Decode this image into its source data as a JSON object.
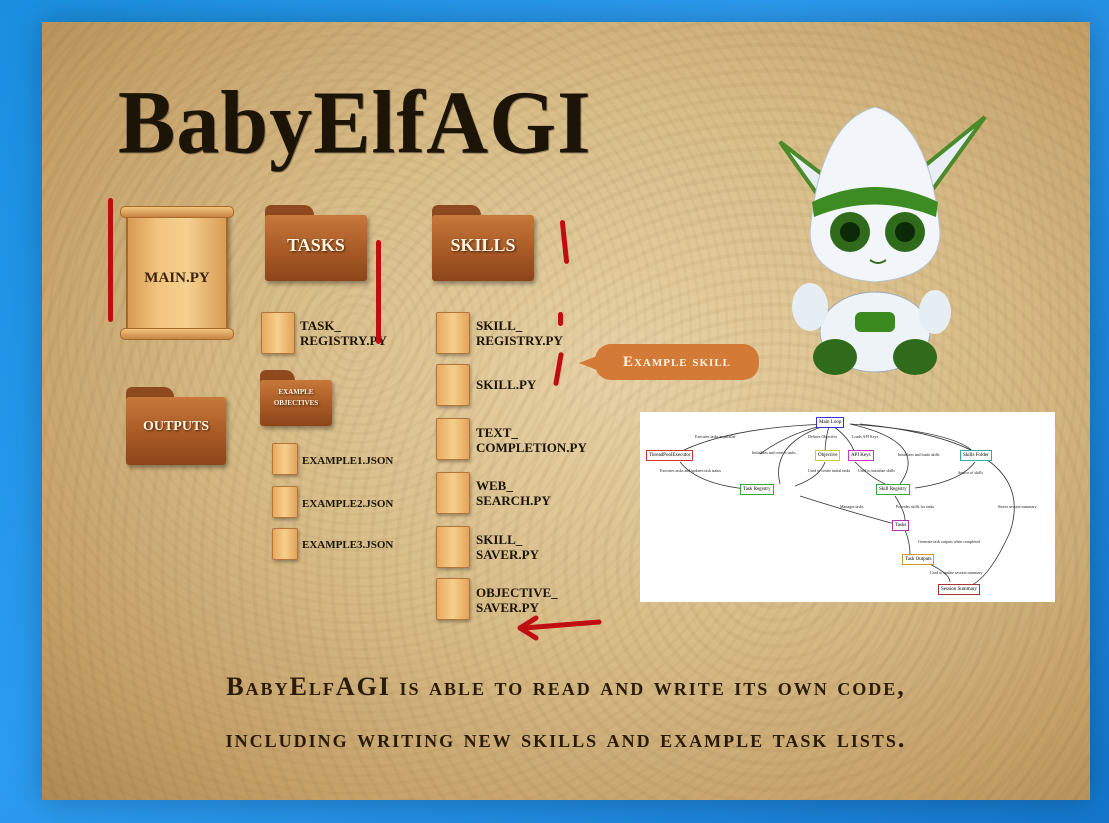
{
  "title": "BabyElfAGI",
  "main_scroll": {
    "label": "MAIN.PY"
  },
  "folders": {
    "outputs": "OUTPUTS",
    "tasks": "TASKS",
    "skills": "SKILLS",
    "example_objectives": "EXAMPLE\nOBJECTIVES"
  },
  "task_files": [
    {
      "name": "TASK_\nREGISTRY.PY"
    }
  ],
  "example_files": [
    {
      "name": "EXAMPLE1.JSON"
    },
    {
      "name": "EXAMPLE2.JSON"
    },
    {
      "name": "EXAMPLE3.JSON"
    }
  ],
  "skill_files": [
    {
      "name": "SKILL_\nREGISTRY.PY"
    },
    {
      "name": "SKILL.PY"
    },
    {
      "name": "TEXT_\nCOMPLETION.PY"
    },
    {
      "name": "WEB_\nSEARCH.PY"
    },
    {
      "name": "SKILL_\nSAVER.PY"
    },
    {
      "name": "OBJECTIVE_\nSAVER.PY"
    }
  ],
  "callout": "Example skill",
  "diagram": {
    "nodes": {
      "main_loop": {
        "label": "Main Loop",
        "color": "#3333cc"
      },
      "executor": {
        "label": "ThreadPoolExecutor",
        "color": "#cc3333"
      },
      "objective": {
        "label": "Objective",
        "color": "#cccc33"
      },
      "api_keys": {
        "label": "API Keys",
        "color": "#cc33cc"
      },
      "skills_folder": {
        "label": "Skills Folder",
        "color": "#33aaaa"
      },
      "task_registry": {
        "label": "Task Registry",
        "color": "#33aa33"
      },
      "skill_registry": {
        "label": "Skill Registry",
        "color": "#33aa33"
      },
      "tasks": {
        "label": "Tasks",
        "color": "#aa33aa"
      },
      "task_outputs": {
        "label": "Task Outputs",
        "color": "#cc9933"
      },
      "session_summary": {
        "label": "Session Summary",
        "color": "#aa3333"
      }
    },
    "edge_labels": {
      "e1": "Executes tasks in parallel",
      "e2": "Defines Objective",
      "e3": "Loads API Keys",
      "e4": "Initializes and creates tasks",
      "e5": "Initializes and loads skills",
      "e6": "Executes tasks and updates task status",
      "e7": "Used to create initial tasks",
      "e8": "Used to initialize skills",
      "e9": "Source of skills",
      "e10": "Manages tasks",
      "e11": "Provides skills for tasks",
      "e12": "Stores session summary",
      "e13": "Generate task outputs when completed",
      "e14": "Used to update session summary"
    }
  },
  "caption": {
    "line1": "BabyElfAGI is able to read and write its own code,",
    "line2": "including writing new skills and example task lists."
  }
}
